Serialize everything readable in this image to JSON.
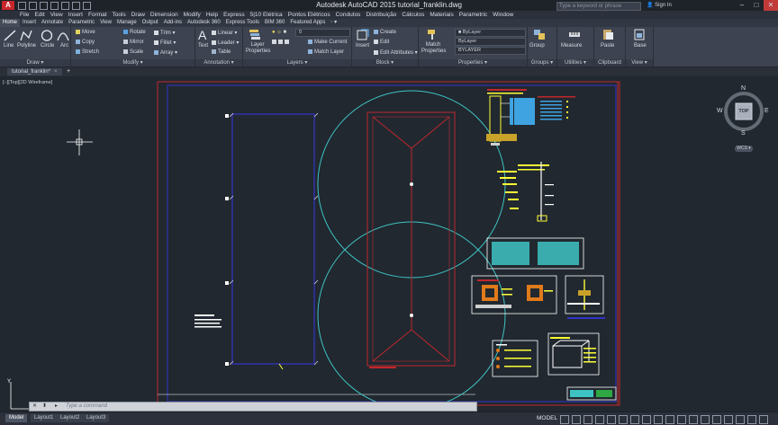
{
  "app": {
    "logo": "A",
    "title": "Autodesk AutoCAD 2015   tutorial_franklin.dwg",
    "search_placeholder": "Type a keyword or phrase",
    "signin": "Sign In"
  },
  "window_controls": [
    "–",
    "□",
    "✕"
  ],
  "menus": [
    "File",
    "Edit",
    "View",
    "Insert",
    "Format",
    "Tools",
    "Draw",
    "Dimension",
    "Modify",
    "Help",
    "Express",
    "5|10 Elétrica",
    "Pontos Elétricos",
    "Condutos",
    "Distribuição",
    "Cálculos",
    "Materiais",
    "Parametric",
    "Window"
  ],
  "ribbon_tabs": [
    "Home",
    "Insert",
    "Annotate",
    "Parametric",
    "View",
    "Manage",
    "Output",
    "Add-ins",
    "Autodesk 360",
    "Express Tools",
    "BIM 360",
    "Featured Apps",
    "◦ ▾"
  ],
  "draw": {
    "title": "Draw ▾",
    "line": "Line",
    "polyline": "Polyline",
    "circle": "Circle",
    "arc": "Arc"
  },
  "modify": {
    "title": "Modify ▾",
    "move": "Move",
    "rotate": "Rotate",
    "trim": "Trim ▾",
    "copy": "Copy",
    "mirror": "Mirror",
    "fillet": "Fillet ▾",
    "stretch": "Stretch",
    "scale": "Scale",
    "array": "Array ▾"
  },
  "annotation": {
    "title": "Annotation ▾",
    "text": "Text",
    "linear": "Linear ▾",
    "leader": "Leader ▾",
    "table": "Table"
  },
  "layers": {
    "title": "Layers ▾",
    "layer_properties": "Layer Properties",
    "current_layer": "0",
    "make_current": "Make Current",
    "match_layer": "Match Layer"
  },
  "block": {
    "title": "Block ▾",
    "insert": "Insert",
    "create": "Create",
    "edit": "Edit",
    "edit_attributes": "Edit Attributes ▾"
  },
  "properties": {
    "title": "Properties ▾",
    "match": "Match Properties",
    "color": "ByLayer",
    "lineweight": "ByLayer",
    "linetype": "BYLAYER"
  },
  "groups": {
    "title": "Groups ▾",
    "group": "Group"
  },
  "utilities": {
    "title": "Utilities ▾",
    "measure": "Measure"
  },
  "clipboard": {
    "title": "Clipboard",
    "paste": "Paste"
  },
  "view_panel": {
    "title": "View ▾",
    "base": "Base"
  },
  "file_tab": {
    "name": "tutorial_franklin*",
    "close": "×",
    "new": "+"
  },
  "viewport": {
    "label": "[−][Top][2D Wireframe]"
  },
  "viewcube": {
    "n": "N",
    "s": "S",
    "e": "E",
    "w": "W",
    "top": "TOP",
    "wcs": "WCS ▾"
  },
  "command": {
    "placeholder": "Type a command",
    "close": "✕",
    "recent": "⬍",
    "prompt": "▸"
  },
  "layout_tabs": [
    "Model",
    "Layout1",
    "Layout2",
    "Layout3"
  ],
  "status": {
    "model": "MODEL"
  },
  "colors": {
    "cyan": "#3ec3c3",
    "red": "#c0272d",
    "blue": "#3434c8",
    "yellow": "#ffff33",
    "white": "#ffffff",
    "bg": "#212830"
  }
}
